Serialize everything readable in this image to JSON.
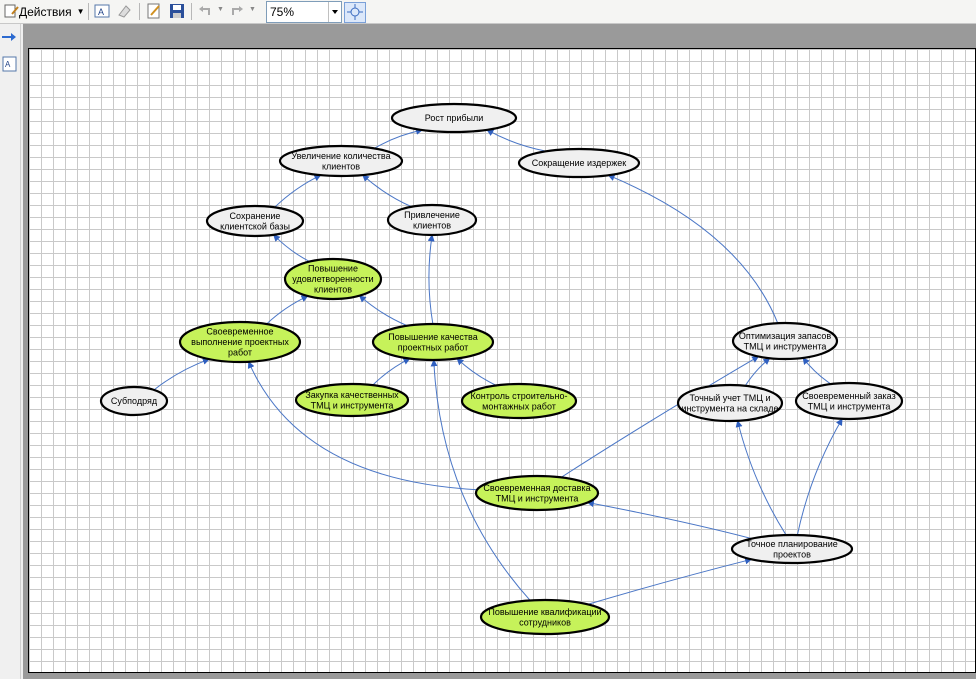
{
  "toolbar": {
    "actions_label": "Действия",
    "zoom_value": "75%"
  },
  "diagram": {
    "nodes": {
      "n1": {
        "lines": [
          "Рост прибыли"
        ],
        "color": "#f0f0f0"
      },
      "n2": {
        "lines": [
          "Увеличение количества",
          "клиентов"
        ],
        "color": "#f0f0f0"
      },
      "n3": {
        "lines": [
          "Сокращение издержек"
        ],
        "color": "#f0f0f0"
      },
      "n4": {
        "lines": [
          "Сохранение",
          "клиентской базы"
        ],
        "color": "#f0f0f0"
      },
      "n5": {
        "lines": [
          "Привлечение",
          "клиентов"
        ],
        "color": "#f0f0f0"
      },
      "n6": {
        "lines": [
          "Повышение",
          "удовлетворенности",
          "клиентов"
        ],
        "color": "#c6f25a"
      },
      "n7": {
        "lines": [
          "Своевременное",
          "выполнение проектных",
          "работ"
        ],
        "color": "#c6f25a"
      },
      "n8": {
        "lines": [
          "Повышение качества",
          "проектных работ"
        ],
        "color": "#c6f25a"
      },
      "n9": {
        "lines": [
          "Оптимизация запасов",
          "ТМЦ и инструмента"
        ],
        "color": "#f0f0f0"
      },
      "n10": {
        "lines": [
          "Субподряд"
        ],
        "color": "#f0f0f0"
      },
      "n11": {
        "lines": [
          "Закупка качественных",
          "ТМЦ и инструмента"
        ],
        "color": "#c6f25a"
      },
      "n12": {
        "lines": [
          "Контроль строительно-",
          "монтажных работ"
        ],
        "color": "#c6f25a"
      },
      "n13": {
        "lines": [
          "Точный учет ТМЦ и",
          "инструмента на складе"
        ],
        "color": "#f0f0f0"
      },
      "n14": {
        "lines": [
          "Своевременный заказ",
          "ТМЦ и инструмента"
        ],
        "color": "#f0f0f0"
      },
      "n15": {
        "lines": [
          "Своевременная доставка",
          "ТМЦ и инструмента"
        ],
        "color": "#c6f25a"
      },
      "n16": {
        "lines": [
          "Точное планирование",
          "проектов"
        ],
        "color": "#f0f0f0"
      },
      "n17": {
        "lines": [
          "Повышение квалификации",
          "сотрудников"
        ],
        "color": "#c6f25a"
      }
    },
    "edges": [
      [
        "n2",
        "n1"
      ],
      [
        "n3",
        "n1"
      ],
      [
        "n4",
        "n2"
      ],
      [
        "n5",
        "n2"
      ],
      [
        "n6",
        "n4"
      ],
      [
        "n7",
        "n6"
      ],
      [
        "n8",
        "n6"
      ],
      [
        "n8",
        "n5"
      ],
      [
        "n10",
        "n7"
      ],
      [
        "n11",
        "n8"
      ],
      [
        "n12",
        "n8"
      ],
      [
        "n9",
        "n3"
      ],
      [
        "n13",
        "n9"
      ],
      [
        "n14",
        "n9"
      ],
      [
        "n15",
        "n9"
      ],
      [
        "n15",
        "n7"
      ],
      [
        "n16",
        "n13"
      ],
      [
        "n16",
        "n14"
      ],
      [
        "n16",
        "n15"
      ],
      [
        "n17",
        "n16"
      ],
      [
        "n17",
        "n8"
      ]
    ],
    "edge_color": "#4a76c6"
  }
}
